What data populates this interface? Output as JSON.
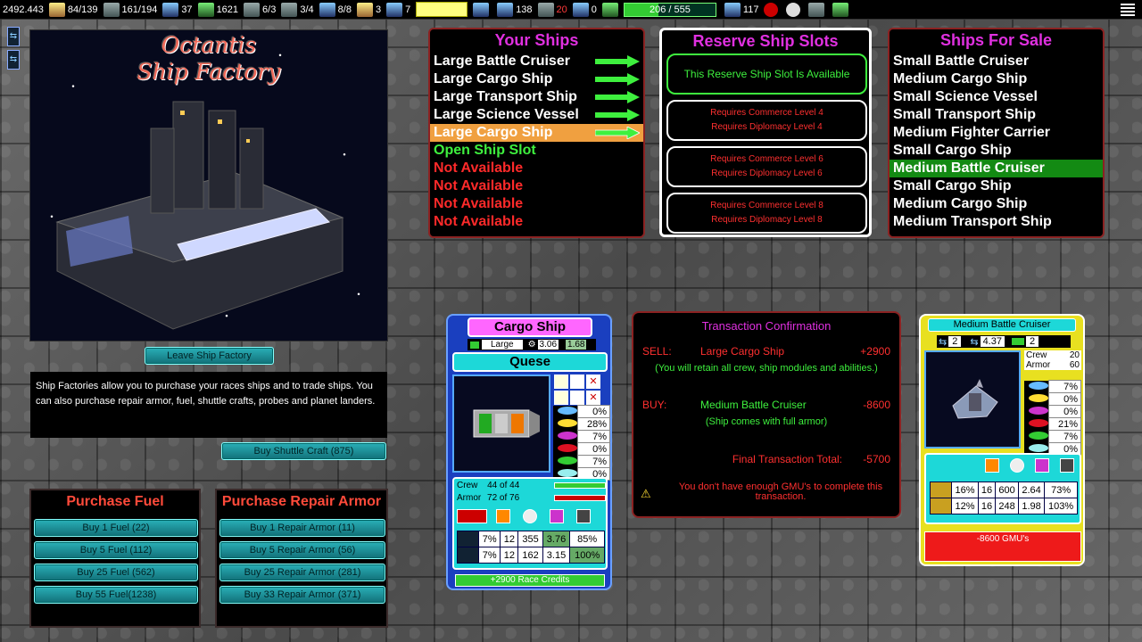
{
  "topbar": {
    "credits": "2492.443",
    "stat1": "84/139",
    "stat2": "161/194",
    "stat3": "37",
    "stat4": "1621",
    "stat5": "6/3",
    "stat6": "3/4",
    "stat7": "8/8",
    "stat8": "3",
    "stat9": "7",
    "stat10": "138",
    "stat11": "20",
    "stat12": "0",
    "bar_text": "206 / 555",
    "bar_fraction": 0.371,
    "stat13": "117"
  },
  "factory": {
    "title_line1": "Octantis",
    "title_line2": "Ship Factory",
    "leave_button": "Leave Ship Factory",
    "description": "Ship Factories allow you to purchase your races ships and to trade ships. You can also purchase repair armor, fuel, shuttle crafts, probes and planet landers.",
    "shuttle_button": "Buy Shuttle Craft (875)"
  },
  "fuel": {
    "title": "Purchase Fuel",
    "buttons": [
      "Buy 1 Fuel (22)",
      "Buy 5 Fuel (112)",
      "Buy 25 Fuel (562)",
      "Buy 55 Fuel(1238)"
    ]
  },
  "armor": {
    "title": "Purchase Repair Armor",
    "buttons": [
      "Buy 1 Repair Armor (11)",
      "Buy 5 Repair Armor (56)",
      "Buy 25 Repair Armor (281)",
      "Buy 33 Repair Armor (371)"
    ]
  },
  "your_ships": {
    "title": "Your Ships",
    "items": [
      {
        "label": "Large Battle Cruiser"
      },
      {
        "label": "Large Cargo Ship"
      },
      {
        "label": "Large Transport Ship"
      },
      {
        "label": "Large Science Vessel"
      },
      {
        "label": "Large Cargo Ship"
      },
      {
        "label": "Open Ship Slot"
      },
      {
        "label": "Not Available"
      },
      {
        "label": "Not Available"
      },
      {
        "label": "Not Available"
      },
      {
        "label": "Not Available"
      }
    ]
  },
  "reserve": {
    "title": "Reserve Ship Slots",
    "slot1": "This Reserve Ship Slot Is Available",
    "slot2_a": "Requires Commerce Level 4",
    "slot2_b": "Requires Diplomacy Level 4",
    "slot3_a": "Requires Commerce Level 6",
    "slot3_b": "Requires Diplomacy Level 6",
    "slot4_a": "Requires Commerce Level 8",
    "slot4_b": "Requires Diplomacy Level 8"
  },
  "for_sale": {
    "title": "Ships For Sale",
    "items": [
      {
        "label": "Small Battle Cruiser"
      },
      {
        "label": "Medium Cargo Ship"
      },
      {
        "label": "Small Science Vessel"
      },
      {
        "label": "Small Transport Ship"
      },
      {
        "label": "Medium Fighter Carrier"
      },
      {
        "label": "Small Cargo Ship"
      },
      {
        "label": "Medium Battle Cruiser"
      },
      {
        "label": "Small Cargo Ship"
      },
      {
        "label": "Medium Cargo Ship"
      },
      {
        "label": "Medium Transport Ship"
      }
    ]
  },
  "cargo_card": {
    "title": "Cargo Ship",
    "size": "Large",
    "val1": "3.06",
    "val2": "1.68",
    "name": "Quese",
    "pcts": [
      "0%",
      "28%",
      "7%",
      "0%",
      "7%",
      "0%"
    ],
    "crew_label": "Crew",
    "crew_val": "44 of 44",
    "armor_label": "Armor",
    "armor_val": "72 of 76",
    "row1": [
      "7%",
      "12",
      "355",
      "3.76",
      "85%"
    ],
    "row2": [
      "7%",
      "12",
      "162",
      "3.15",
      "100%"
    ],
    "footer": "+2900 Race Credits"
  },
  "transaction": {
    "title": "Transaction Confirmation",
    "sell_label": "SELL:",
    "sell_item": "Large Cargo Ship",
    "sell_amount": "+2900",
    "sell_note": "(You will retain all crew, ship modules and abilities.)",
    "buy_label": "BUY:",
    "buy_item": "Medium Battle Cruiser",
    "buy_amount": "-8600",
    "buy_note": "(Ship comes with full armor)",
    "total_label": "Final Transaction Total:",
    "total_amount": "-5700",
    "warning": "You don't have enough GMU's to complete this transaction."
  },
  "battle_card": {
    "title": "Medium Battle Cruiser",
    "v1": "2",
    "v2": "4.37",
    "v3": "2",
    "crew_label": "Crew",
    "crew_val": "20",
    "armor_label": "Armor",
    "armor_val": "60",
    "pcts": [
      "7%",
      "0%",
      "0%",
      "21%",
      "7%",
      "0%"
    ],
    "row1": [
      "16%",
      "16",
      "600",
      "2.64",
      "73%"
    ],
    "row2": [
      "12%",
      "16",
      "248",
      "1.98",
      "103%"
    ],
    "footer": "-8600 GMU's"
  }
}
